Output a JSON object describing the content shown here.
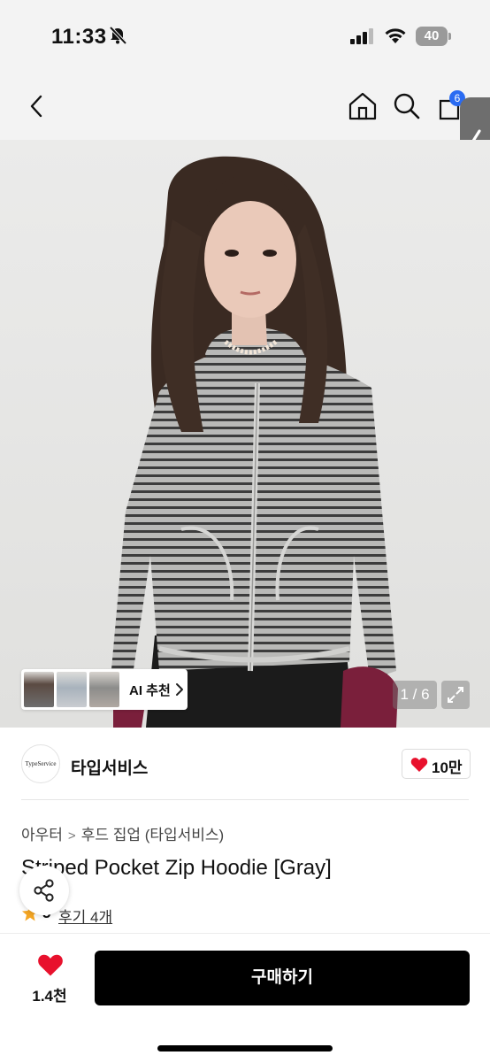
{
  "status_bar": {
    "time": "11:33",
    "battery": "40",
    "icons": [
      "bell-off-icon",
      "signal-icon",
      "wifi-icon",
      "battery-icon"
    ]
  },
  "nav": {
    "icons": [
      "back-icon",
      "home-icon",
      "search-icon",
      "cart-icon"
    ],
    "cart_badge": "6"
  },
  "gallery": {
    "ai_label": "AI 추천",
    "page_counter": "1 / 6",
    "current_page": 1,
    "total_pages": 6
  },
  "brand": {
    "logo_text": "TypeService",
    "name": "타입서비스",
    "likes": "10만"
  },
  "product": {
    "breadcrumb": [
      "아우터",
      "후드 집업 (타입서비스)"
    ],
    "title": "Striped Pocket Zip Hoodie [Gray]",
    "rating": "5",
    "review_link": "후기 4개"
  },
  "bottom_bar": {
    "wish_count": "1.4천",
    "buy_label": "구매하기"
  },
  "colors": {
    "accent_heart": "#e8112d",
    "cart_badge": "#2a6bf2",
    "buy_button": "#000000",
    "star": "#f5a623"
  }
}
